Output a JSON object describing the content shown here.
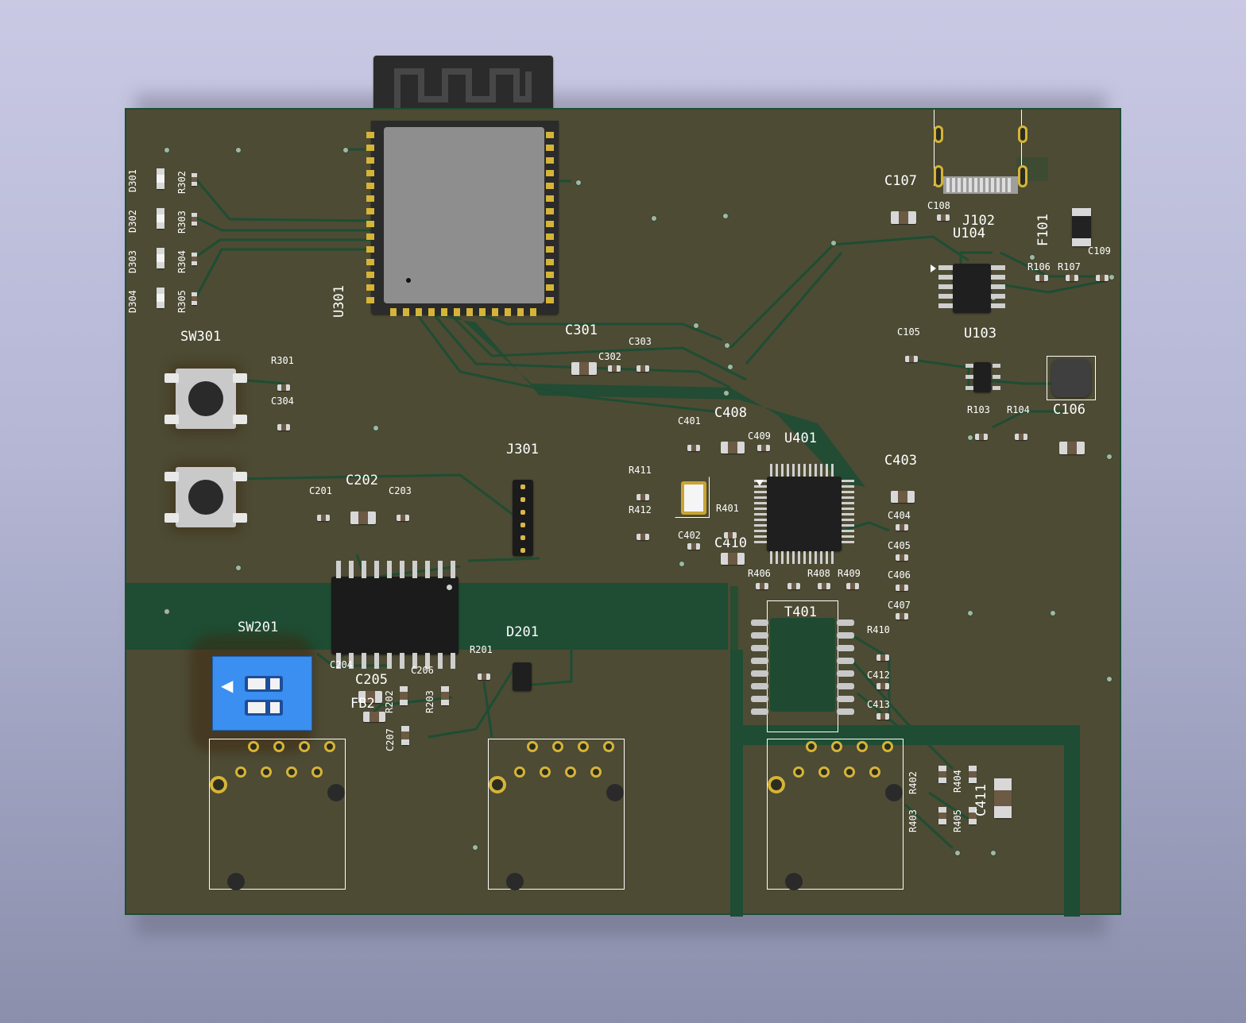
{
  "colors": {
    "board": "#4d4b34",
    "copper_trace": "#1e4d33",
    "silkscreen": "#ffffff",
    "pad_gold": "#d5b437",
    "dip_switch_blue": "#3a8ff0"
  },
  "icons": {
    "dip_arrow": "left-arrow-icon"
  },
  "refs": {
    "D301": "D301",
    "D302": "D302",
    "D303": "D303",
    "D304": "D304",
    "R302": "R302",
    "R303": "R303",
    "R304": "R304",
    "R305": "R305",
    "U301": "U301",
    "SW301": "SW301",
    "R301": "R301",
    "C304": "C304",
    "C301": "C301",
    "C302": "C302",
    "C303": "C303",
    "C201": "C201",
    "C202": "C202",
    "C203": "C203",
    "J301": "J301",
    "SW201": "SW201",
    "D201": "D201",
    "R201": "R201",
    "C204": "C204",
    "C205": "C205",
    "C206": "C206",
    "C207": "C207",
    "FB201": "FB2",
    "R202": "R202",
    "R203": "R203",
    "C401": "C401",
    "C402": "C402",
    "C408": "C408",
    "C409": "C409",
    "C410": "C410",
    "U401": "U401",
    "R411": "R411",
    "R412": "R412",
    "R401": "R401",
    "R406": "R406",
    "R408": "R408",
    "R409": "R409",
    "R410": "R410",
    "C403": "C403",
    "C404": "C404",
    "C405": "C405",
    "C406": "C406",
    "C407": "C407",
    "C412": "C412",
    "C413": "C413",
    "T401": "T401",
    "R402": "R402",
    "R403": "R403",
    "R404": "R404",
    "R405": "R405",
    "C411": "C411",
    "C107": "C107",
    "C108": "C108",
    "J102": "J102",
    "U104": "U104",
    "F101": "F101",
    "C109": "C109",
    "R106": "R106",
    "R107": "R107",
    "U103": "U103",
    "C105": "C105",
    "R103": "R103",
    "R104": "R104",
    "C106": "C106"
  }
}
